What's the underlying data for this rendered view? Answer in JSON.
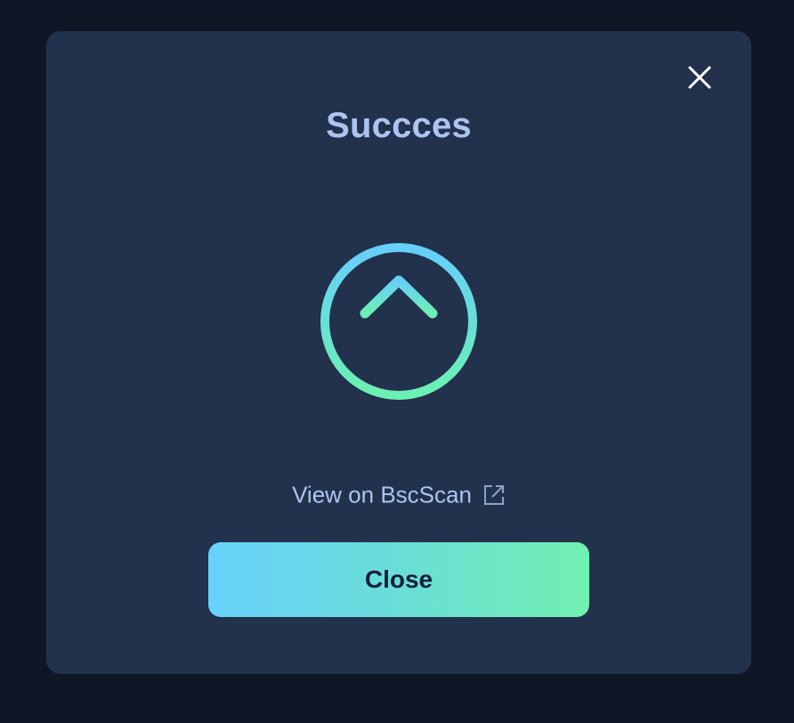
{
  "modal": {
    "title": "Succces",
    "close_icon": "close-icon",
    "status_icon": "upload-arrow-circle-icon",
    "link": {
      "label": "View on BscScan",
      "icon": "external-link-icon"
    },
    "close_button_label": "Close"
  },
  "colors": {
    "backdrop": "#0f1727",
    "modal_background": "#22314c",
    "title_text": "#aec4f0",
    "gradient_start": "#67d1fb",
    "gradient_end": "#72f0b0",
    "button_text": "#14203a"
  }
}
